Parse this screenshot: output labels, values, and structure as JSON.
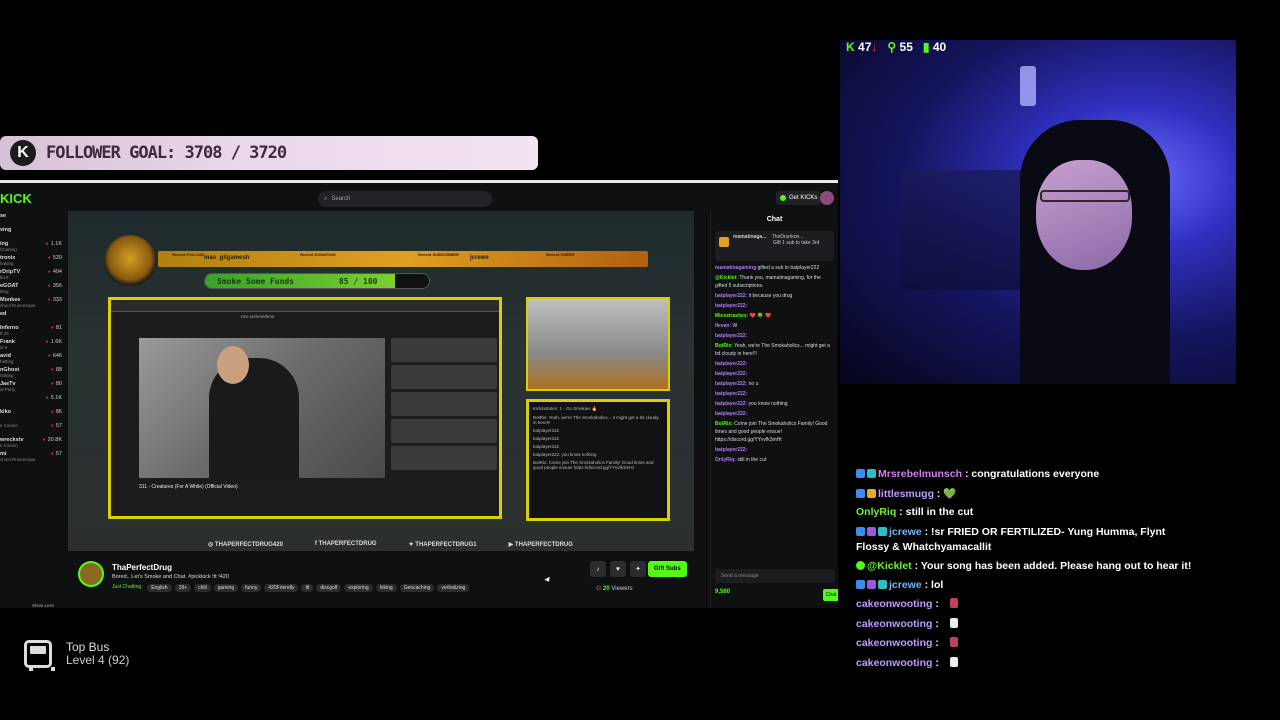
{
  "follower_goal": {
    "logo": "K",
    "label": "FOLLOWER GOAL: 3708 / 3720",
    "current": 3708,
    "target": 3720
  },
  "webcam_stats": {
    "kicks": "47",
    "kicks_trend": "down",
    "followers": "55",
    "viewers": "40",
    "kick_icon": "kick-icon",
    "follower_icon": "person-icon",
    "viewer_icon": "bar-chart-icon",
    "accent": "#53fc18"
  },
  "kick_page": {
    "logo": "KICK",
    "search_placeholder": "Search",
    "get_kicks_label": "Get KICKs",
    "left_nav": [
      {
        "name": "se",
        "sub": "",
        "value": ""
      },
      {
        "name": "ving",
        "sub": "",
        "value": ""
      },
      {
        "name": "ing",
        "sub": "Chatting",
        "value": "1.1K"
      },
      {
        "name": "tronix",
        "sub": "hatting",
        "value": "520"
      },
      {
        "name": "rDripTV",
        "sub": "tld 6",
        "value": "404"
      },
      {
        "name": "eGOAT",
        "sub": "tting",
        "value": "356"
      },
      {
        "name": "Monkee",
        "sub": "chool RuneScape",
        "value": "333"
      },
      {
        "name": "ed",
        "sub": "",
        "value": ""
      },
      {
        "name": "Inferno",
        "sub": "ft 25",
        "value": "81"
      },
      {
        "name": "Frank",
        "sub": "ld 6",
        "value": "1.6K"
      },
      {
        "name": "avid",
        "sub": "hatting",
        "value": "646"
      },
      {
        "name": "nGhost",
        "sub": "hatting",
        "value": "88"
      },
      {
        "name": "JaeTv",
        "sub": "al Party",
        "value": "80"
      },
      {
        "name": "",
        "sub": "",
        "value": "5.1K"
      },
      {
        "name": "kiko",
        "sub": "",
        "value": "86"
      },
      {
        "name": "",
        "sub": "e Casino",
        "value": "57"
      },
      {
        "name": "wreckstv",
        "sub": "e Casino",
        "value": "20.8K"
      },
      {
        "name": "mi",
        "sub": "chool RuneScape",
        "value": "57"
      }
    ],
    "show_less": "Show Less",
    "player": {
      "banner": {
        "follow_label": "Recent FOLLOW",
        "follow_name": "mao_gilgamesh",
        "donation_label": "Recent DONATION",
        "subscriber_label": "Recent SUBSCRIBER",
        "subscriber_name": "jcrewe",
        "cheer_label": "Recent CHEER"
      },
      "funds_label": "Smoke Some Funds",
      "funds_current": "85",
      "funds_target": "100",
      "funds_progress": 0.85,
      "yt_search": "neo summertime",
      "yt_video_title": "311 - Creatures (For A While) (Official Video)",
      "small_chat": [
        "Kickinstutes: 1 - Go Smokies 🔥",
        "BotRix: Yeah, we're The Smokaholics... it might get a bit cloudy in here!!!",
        "batplayer222",
        "batplayer222",
        "batplayer222",
        "batplayer222: you know nothing",
        "BotRix: Come join The Smokaholics Family! Good times and good people ensue! https://discord.gg/YYvvfk3mHt"
      ],
      "socials": [
        {
          "icon": "instagram-icon",
          "label": "THAPERFECTDRUG420"
        },
        {
          "icon": "facebook-icon",
          "label": "THAPERFECTDRUG"
        },
        {
          "icon": "twitter-icon",
          "label": "THAPERFECTDRUG1"
        },
        {
          "icon": "youtube-icon",
          "label": "THAPERFECTDRUG"
        }
      ]
    },
    "stream_info": {
      "name": "ThaPerfectDrug",
      "title": "Bored.. Let's Smoke and Chat. #pickkick !tt !420",
      "category": "Just Chatting",
      "tags": [
        "English",
        "18+",
        "chill",
        "gaming",
        "funny",
        "420Friendly",
        "ttl",
        "discgolf",
        "exploring",
        "hiking",
        "Geocaching",
        "verbalizing"
      ],
      "live_badge": "LIVE",
      "gift_subs_label": "Gift Subs",
      "viewers_count": "20",
      "viewers_label": "Viewers"
    },
    "chat": {
      "title": "Chat",
      "pinned_name": "mamatinaga...",
      "pinned_count": "10",
      "pinned_other": "TheDrunkon...",
      "pinned_other_text": "Gift 1 sub to take 3rd",
      "lines": [
        {
          "user": "mamatinagaming",
          "text": "gifted a sub to batplayer222",
          "green": false
        },
        {
          "user": "@Kicklet:",
          "text": "Thank you, mamatinagaming, for the gifted 5 subscriptions.",
          "green": true
        },
        {
          "user": "batplayer222:",
          "text": "it because you drug",
          "green": false
        },
        {
          "user": "batplayer222:",
          "text": "",
          "green": false
        },
        {
          "user": "Miesstrashes:",
          "text": "❤️ 🍀 ❤️",
          "green": true
        },
        {
          "user": "flevan:",
          "text": "W",
          "green": false
        },
        {
          "user": "batplayer222:",
          "text": "",
          "green": false
        },
        {
          "user": "BotRix:",
          "text": "Yeah, we're The Smokaholics... might get a bit cloudy in here!!!",
          "green": true
        },
        {
          "user": "batplayer222:",
          "text": "",
          "green": false
        },
        {
          "user": "batplayer222:",
          "text": "",
          "green": false
        },
        {
          "user": "batplayer222:",
          "text": "no u",
          "green": false
        },
        {
          "user": "batplayer222:",
          "text": "",
          "green": false
        },
        {
          "user": "batplayer222:",
          "text": "you know nothing",
          "green": false
        },
        {
          "user": "batplayer222:",
          "text": "",
          "green": false
        },
        {
          "user": "BotRix:",
          "text": "Come join The Smokaholics Family! Good times and good people ensue! https://discord.gg/YYvvfk3mHt",
          "green": true
        },
        {
          "user": "batplayer222:",
          "text": "",
          "green": false
        },
        {
          "user": "OnlyRiq:",
          "text": "still in the cut",
          "green": false
        }
      ],
      "input_placeholder": "Send a message",
      "kicks_count": "9,560",
      "chat_button": "Chat"
    }
  },
  "overlay_chat": [
    {
      "user": "Mrsrebelmunsch",
      "sep": " : ",
      "text": "congratulations everyone",
      "color": "pink",
      "badges": [
        "blue",
        "teal"
      ]
    },
    {
      "user": "littlesmugg",
      "sep": " : ",
      "text": "💚",
      "color": "purple",
      "badges": [
        "blue",
        "gold"
      ]
    },
    {
      "user": "OnlyRiq",
      "sep": " : ",
      "text": "still in the cut",
      "color": "green",
      "badges": []
    },
    {
      "user": "jcrewe",
      "sep": " : ",
      "text": "!sr FRIED OR FERTILIZED- Yung Humma, Flynt Flossy & Whatchyamacallit",
      "color": "blue",
      "badges": [
        "blue",
        "purple",
        "teal"
      ]
    },
    {
      "user": "@Kicklet",
      "sep": " : ",
      "text": "Your song has been added. Please hang out to hear it!",
      "color": "green",
      "badges": [
        "green"
      ]
    },
    {
      "user": "jcrewe",
      "sep": " : ",
      "text": "lol",
      "color": "blue",
      "badges": [
        "blue",
        "purple",
        "teal"
      ]
    },
    {
      "user": "cakeonwooting",
      "sep": " : ",
      "text": "",
      "color": "purple",
      "badges": []
    },
    {
      "user": "cakeonwooting",
      "sep": " : ",
      "text": "",
      "color": "purple",
      "badges": []
    },
    {
      "user": "cakeonwooting",
      "sep": " : ",
      "text": "",
      "color": "purple",
      "badges": []
    },
    {
      "user": "cakeonwooting",
      "sep": " : ",
      "text": "",
      "color": "purple",
      "badges": []
    }
  ],
  "top_bus": {
    "title": "Top Bus",
    "level": "Level 4 (92)",
    "icon": "bus-icon"
  }
}
